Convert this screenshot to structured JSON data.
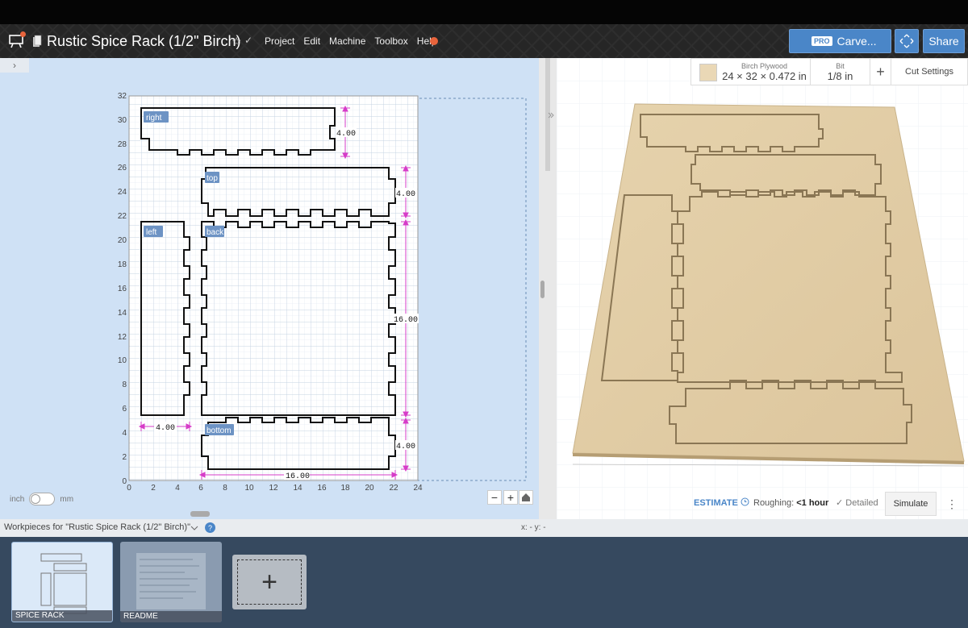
{
  "header": {
    "title": "Rustic Spice Rack (1/2\" Birch)",
    "menu": [
      "Project",
      "Edit",
      "Machine",
      "Toolbox",
      "Help"
    ],
    "carve": {
      "badge": "PRO",
      "label": "Carve..."
    },
    "share_label": "Share"
  },
  "material": {
    "name": "Birch Plywood",
    "dims": "24 × 32 × 0.472 in",
    "bit_label": "Bit",
    "bit_value": "1/8 in",
    "add_symbol": "+",
    "cut_settings": "Cut Settings"
  },
  "canvas": {
    "collapse": "›",
    "x_ticks": [
      "0",
      "2",
      "4",
      "6",
      "8",
      "10",
      "12",
      "14",
      "16",
      "18",
      "20",
      "22",
      "24"
    ],
    "y_ticks": [
      "0",
      "2",
      "4",
      "6",
      "8",
      "10",
      "12",
      "14",
      "16",
      "18",
      "20",
      "22",
      "24",
      "26",
      "28",
      "30",
      "32"
    ],
    "labels": {
      "right": "right",
      "top": "top",
      "left": "left",
      "back": "back",
      "bottom": "bottom"
    },
    "dims": {
      "right_h": "4.00",
      "top_h": "4.00",
      "back_h": "16.00",
      "bottom_h": "4.00",
      "left_w": "4.00",
      "bottom_w": "16.00"
    },
    "units": {
      "inch": "inch",
      "mm": "mm"
    },
    "zoom_out": "−",
    "zoom_in": "+"
  },
  "estimate": {
    "label": "ESTIMATE",
    "roughing_label": "Roughing:",
    "roughing_value": "<1 hour",
    "detailed_label": "Detailed",
    "simulate": "Simulate",
    "more": "⋮"
  },
  "workpieces": {
    "title": "Workpieces for \"Rustic Spice Rack (1/2\" Birch)\"",
    "help": "?",
    "coords": "x: - y: -",
    "items": [
      {
        "label": "SPICE RACK"
      },
      {
        "label": "README"
      }
    ],
    "add": "+"
  }
}
